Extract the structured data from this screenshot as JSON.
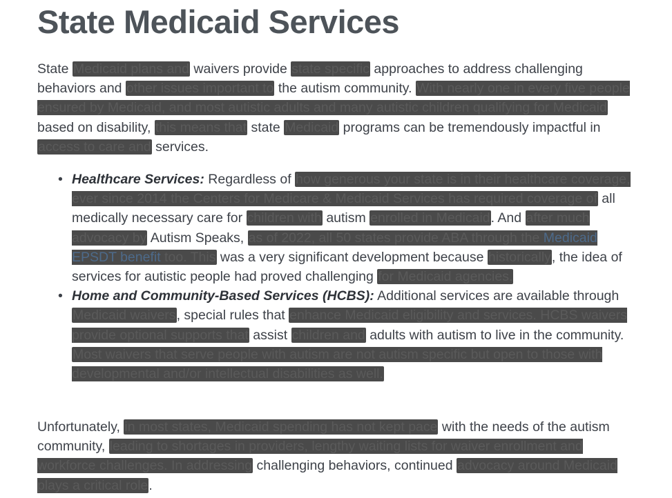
{
  "title": "State Medicaid Services",
  "intro": {
    "t1": "State ",
    "r1": "Medicaid plans and",
    "t2": " waivers provide ",
    "r2": "state specific",
    "t3": " approaches to address challenging behaviors and ",
    "r3": "other issues important to",
    "t4": " the autism community. ",
    "r4": "With nearly one in every five people ensured by Medicaid, and most autistic adults and many autistic children qualifying for Medicaid",
    "t5": " based on disability, ",
    "r5": "this means that",
    "t6": " state ",
    "r6": "Medicaid",
    "t7": " programs can be tremendously impactful in ",
    "r7": "access to care and",
    "t8": " services."
  },
  "items": [
    {
      "lead": "Healthcare Services:",
      "t1": " Regardless of ",
      "r1": "how generous your state is in their healthcare coverage, ever since 2014 the Centers for Medicare & Medicaid Services has required coverage of",
      "t2": " all medically necessary care for ",
      "r2": "children with",
      "t3": " autism ",
      "r3": "enrolled in Medicaid",
      "t4": ". And ",
      "r4": "after much advocacy by",
      "t5": " Autism Speaks, ",
      "r5a": "as of 2022, all 50 states provide ABA through the ",
      "r5link": "Medicaid EPSDT benefit",
      "r5b": " too. This",
      "t6": " was a very significant development because ",
      "r6": "historically",
      "t7": ", the idea of services for autistic people had proved challenging ",
      "r7": "for Medicaid agencies."
    },
    {
      "lead": "Home and Community-Based Services (HCBS):",
      "t1": " Additional services are available through ",
      "r1": "Medicaid waivers",
      "t2": ", special rules that ",
      "r2": "enhance Medicaid eligibility and services. HCBS waivers provide optional supports that",
      "t3": " assist ",
      "r3": "children and",
      "t4": " adults with autism to live in the community. ",
      "r4": "Most waivers that serve people with autism are not autism specific but open to those with developmental and/or intellectual disabilities as well."
    }
  ],
  "closing": {
    "t1": "Unfortunately, ",
    "r1": "in most states, Medicaid spending has not kept pace",
    "t2": " with the needs of the autism community, ",
    "r2": "leading to shortages in providers, lengthy waiting lists for waiver enrollment and workforce challenges. In addressing",
    "t3": " challenging behaviors, continued ",
    "r3": "advocacy around Medicaid plays a critical role",
    "t4": "."
  }
}
